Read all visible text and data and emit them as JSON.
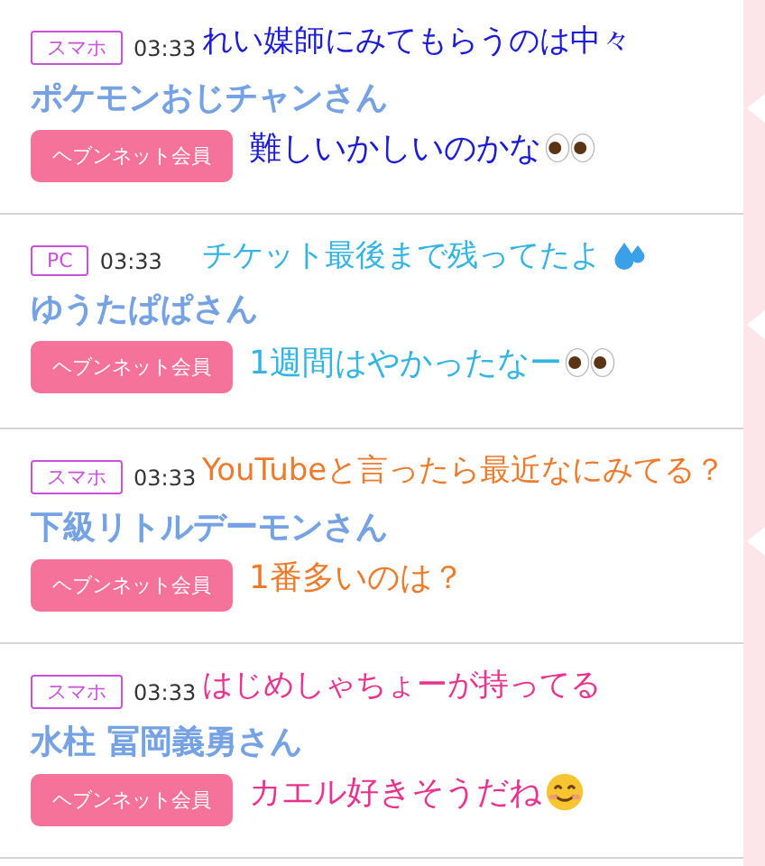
{
  "rows": [
    {
      "tag": "スマホ",
      "time": "03:33",
      "name": "ポケモンおじチャンさん",
      "member_button": "ヘブンネット会員",
      "color": "#1c1cd6",
      "captions": [
        {
          "text": "れい媒師にみてもらうのは中々",
          "kind": "plain"
        },
        {
          "text": "難しいかしいのかな",
          "kind": "eyes"
        }
      ]
    },
    {
      "tag": "PC",
      "time": "03:33",
      "name": "ゆうたぱぱさん",
      "member_button": "ヘブンネット会員",
      "color": "#33b4e2",
      "captions": [
        {
          "text": "チケット最後まで残ってたよ",
          "kind": "drops"
        },
        {
          "text": "1週間はやかったなー",
          "kind": "eyes"
        }
      ]
    },
    {
      "tag": "スマホ",
      "time": "03:33",
      "name": "下級リトルデーモンさん",
      "member_button": "ヘブンネット会員",
      "color": "#ee7a2c",
      "captions": [
        {
          "text": "YouTubeと言ったら最近なにみてる？",
          "kind": "plain"
        },
        {
          "text": "1番多いのは？",
          "kind": "plain"
        }
      ]
    },
    {
      "tag": "スマホ",
      "time": "03:33",
      "name": "水柱 冨岡義勇さん",
      "member_button": "ヘブンネット会員",
      "color": "#e8338f",
      "captions": [
        {
          "text": "はじめしゃちょーが持ってる",
          "kind": "plain"
        },
        {
          "text": "カエル好きそうだね",
          "kind": "smile"
        }
      ]
    }
  ]
}
